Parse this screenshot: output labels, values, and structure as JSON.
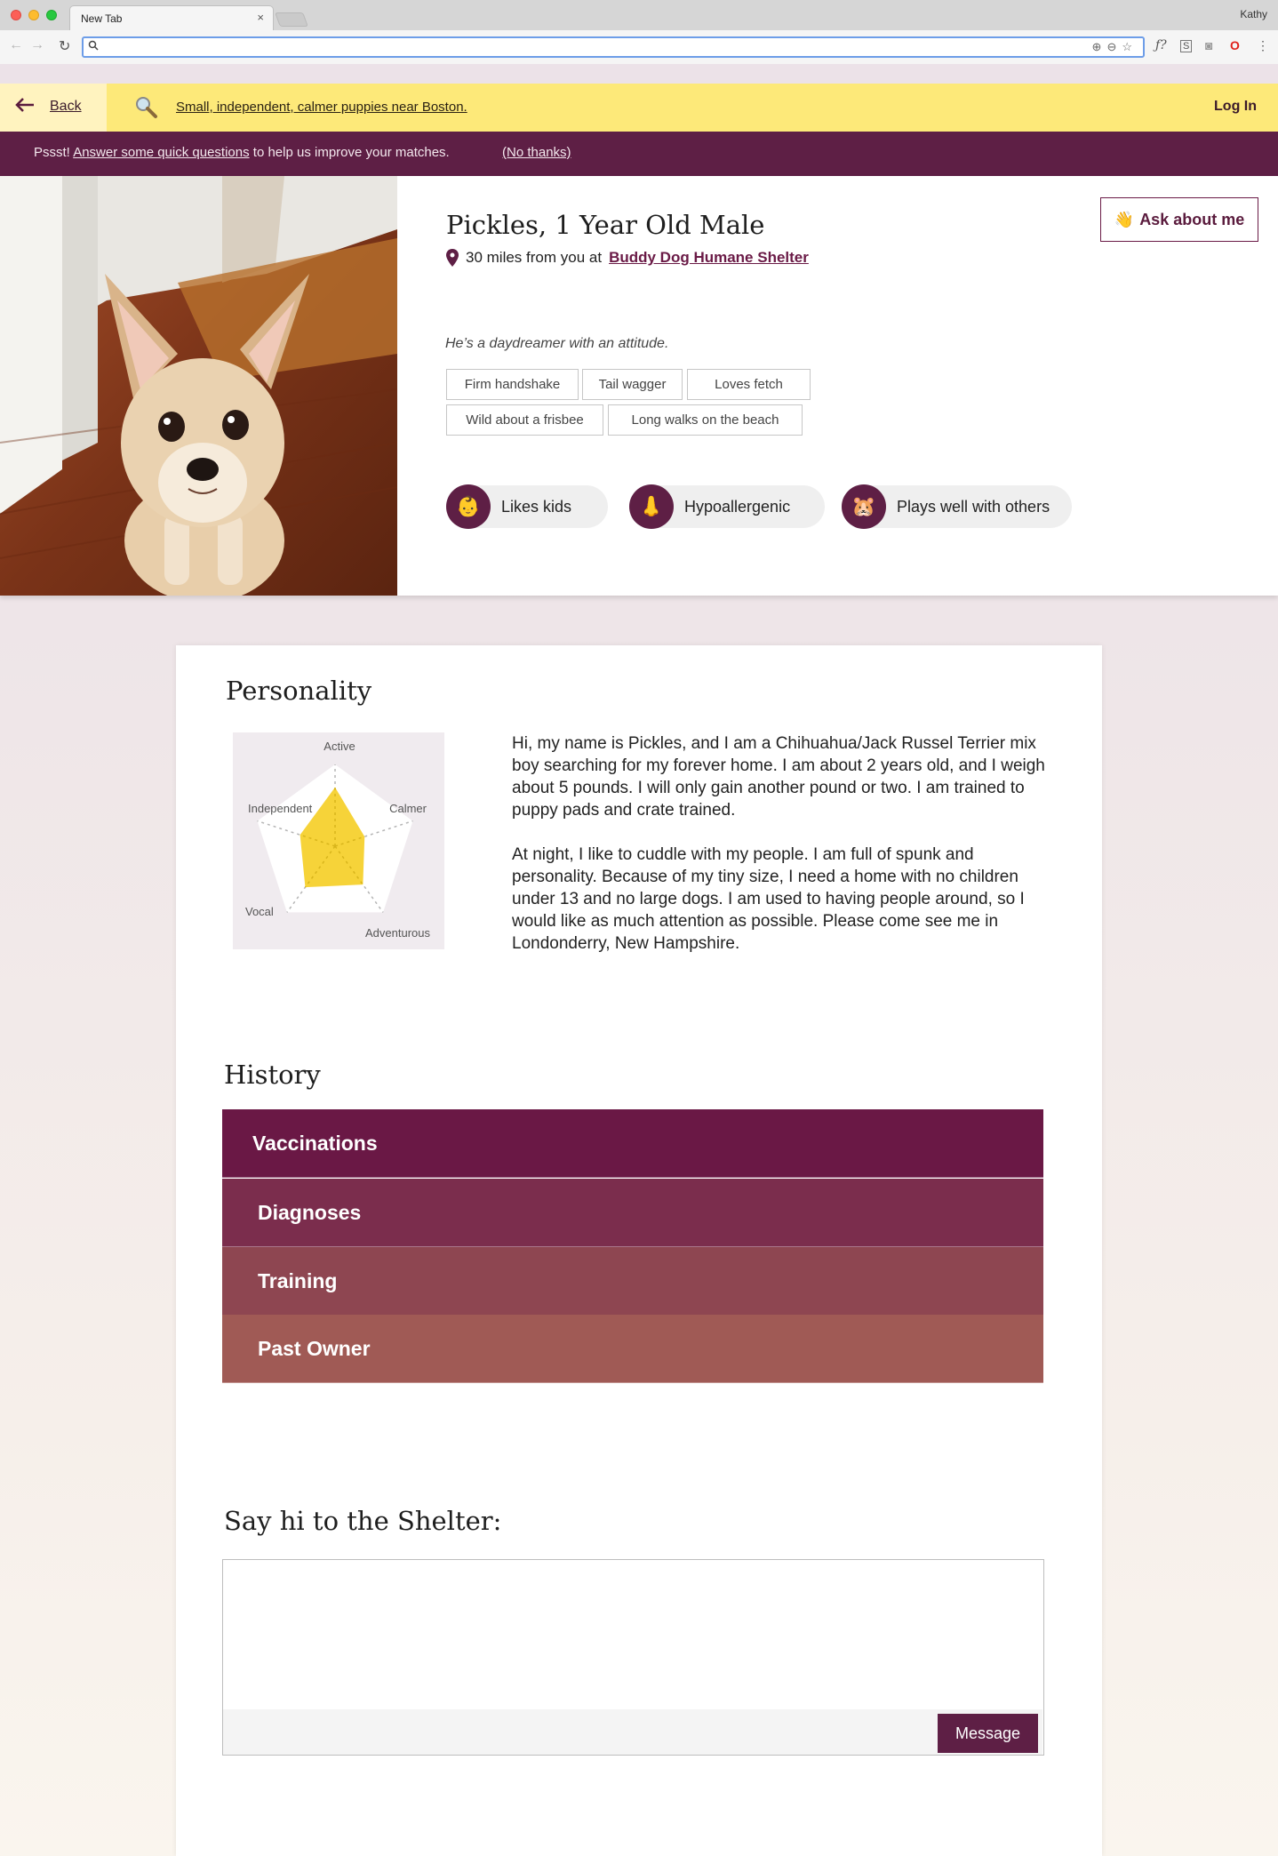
{
  "browser": {
    "tab_title": "New Tab",
    "tab_close": "×",
    "profile_name": "Kathy",
    "url": ""
  },
  "header": {
    "back_label": "Back",
    "search_query": "Small, independent, calmer puppies near Boston.",
    "login_label": "Log In"
  },
  "promo": {
    "prefix": "Pssst! ",
    "link": "Answer some quick questions",
    "suffix": " to help us improve your matches.",
    "dismiss": "(No thanks)"
  },
  "dog": {
    "name": "Pickles, 1 Year Old Male",
    "distance": "30 miles from you at",
    "shelter": "Buddy Dog Humane Shelter",
    "ask_label": "Ask about me",
    "tagline": "He’s a daydreamer with an attitude.",
    "traits": [
      "Firm handshake",
      "Tail wagger",
      "Loves fetch",
      "Wild about a frisbee",
      "Long walks on the beach"
    ],
    "badges": [
      {
        "label": "Likes kids",
        "icon": "baby-face-icon"
      },
      {
        "label": "Hypoallergenic",
        "icon": "nose-icon"
      },
      {
        "label": "Plays well with others",
        "icon": "hamster-icon"
      }
    ]
  },
  "personality": {
    "title": "Personality",
    "chart_data": {
      "type": "radar",
      "axes": [
        "Active",
        "Calmer",
        "Adventurous",
        "Vocal",
        "Independent"
      ],
      "values": [
        0.72,
        0.38,
        0.58,
        0.62,
        0.45
      ],
      "range": [
        0,
        1
      ],
      "fill_color": "#f6d12e"
    },
    "bio": [
      "Hi, my name is Pickles, and I am a Chihuahua/Jack Russel Terrier mix boy searching for my forever home. I am about 2 years old, and I weigh about 5 pounds. I will only gain another pound or two. I am trained to puppy pads and crate trained.",
      "At night, I like to cuddle with my people. I am full of spunk and personality. Because of my tiny size, I need a home with no children under 13 and no large dogs. I am used to having people around, so I would like as much attention as possible. Please come see me in Londonderry, New Hampshire."
    ]
  },
  "history": {
    "title": "History",
    "items": [
      {
        "label": "Vaccinations",
        "color": "#6a1845"
      },
      {
        "label": "Diagnoses",
        "color": "#7b2d4d"
      },
      {
        "label": "Training",
        "color": "#8e4651"
      },
      {
        "label": "Past Owner",
        "color": "#a05a55"
      }
    ]
  },
  "contact": {
    "title": "Say hi to the Shelter:",
    "placeholder": "",
    "button_label": "Message"
  },
  "colors": {
    "brand": "#5e1f45",
    "header_yellow": "#fde979",
    "radar_yellow": "#f6d12e"
  }
}
